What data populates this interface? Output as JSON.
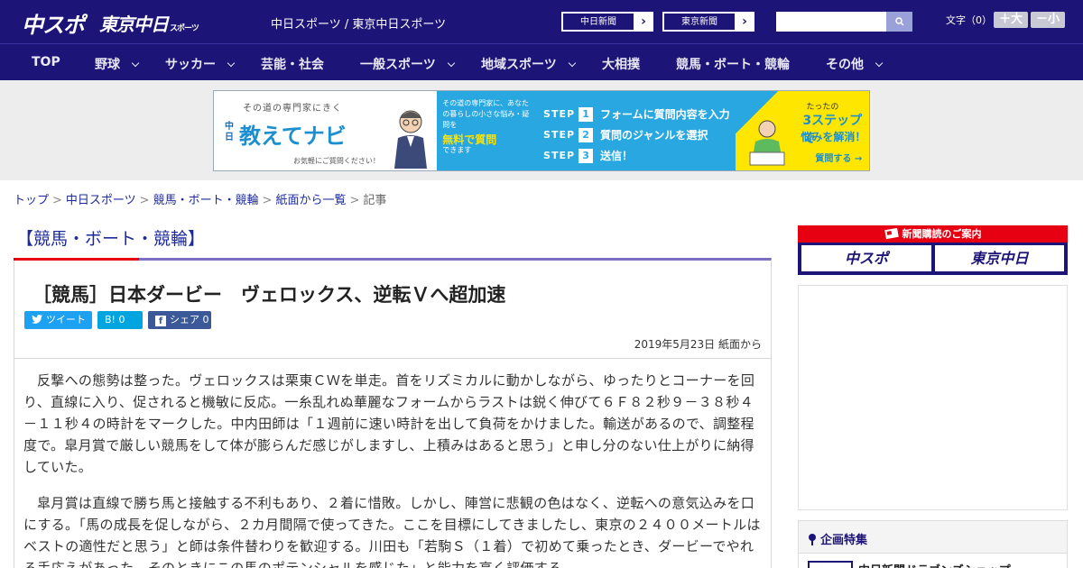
{
  "header": {
    "logo_main": "中スポ",
    "logo_tokyo": "東京中日",
    "logo_tokyo_sub": "スポーツ",
    "site_title": "中日スポーツ / 東京中日スポーツ",
    "link_chunichi": "中日新聞",
    "link_tokyo": "東京新聞",
    "fontsize_label": "文字（0）",
    "fontsize_up": "＋大",
    "fontsize_down": "－小"
  },
  "nav": {
    "items": [
      {
        "label": "TOP"
      },
      {
        "label": "野球"
      },
      {
        "label": "サッカー"
      },
      {
        "label": "芸能・社会"
      },
      {
        "label": "一般スポーツ"
      },
      {
        "label": "地域スポーツ"
      },
      {
        "label": "大相撲"
      },
      {
        "label": "競馬・ボート・競輪"
      },
      {
        "label": "その他"
      }
    ]
  },
  "banner": {
    "tagline": "その道の専門家にきく",
    "brand_small": "中日",
    "brand": "教えてナビ",
    "brand_sub": "お気軽にご質問ください！",
    "mid_text": "その道の専門家に、あなたの暮らしの小さな悩み・疑問を",
    "mid_free": "無料で質問",
    "mid_end": "できます",
    "step_word": "STEP",
    "steps": [
      {
        "num": "1",
        "text": "フォームに質問内容を入力"
      },
      {
        "num": "2",
        "text": "質問のジャンルを選択"
      },
      {
        "num": "3",
        "text": "送信！"
      }
    ],
    "r1": "たったの",
    "r2": "3ステップで",
    "r3": "悩みを解消！",
    "r4": "質問する →"
  },
  "breadcrumb": {
    "items": [
      "トップ",
      "中日スポーツ",
      "競馬・ボート・競輪",
      "紙面から一覧"
    ],
    "current": "記事",
    "sep": ">"
  },
  "article": {
    "category": "【競馬・ボート・競輪】",
    "title": "［競馬］日本ダービー　ヴェロックス、逆転Ｖへ超加速",
    "share_tweet": "ツイート",
    "share_hatena": "B! 0",
    "share_fb": "シェア 0",
    "date": "2019年5月23日 紙面から",
    "paragraphs": [
      "反撃への態勢は整った。ヴェロックスは栗東ＣＷを単走。首をリズミカルに動かしながら、ゆったりとコーナーを回り、直線に入り、促されると機敏に反応。一糸乱れぬ華麗なフォームからラストは鋭く伸びて６Ｆ８２秒９－３８秒４－１１秒４の時計をマークした。中内田師は「１週前に速い時計を出して負荷をかけました。輸送があるので、調整程度で。皐月賞で厳しい競馬をして体が膨らんだ感じがしますし、上積みはあると思う」と申し分のない仕上がりに納得していた。",
      "皐月賞は直線で勝ち馬と接触する不利もあり、２着に惜敗。しかし、陣営に悲観の色はなく、逆転への意気込みを口にする。「馬の成長を促しながら、２カ月間隔で使ってきた。ここを目標にしてきましたし、東京の２４００メートルはベストの適性だと思う」と師は条件替わりを歓迎する。川田も「若駒Ｓ（１着）で初めて乗ったとき、ダービーでやれる手応えがあった。そのときにこの馬のポテンシャルを感じた」と能力を高く評価する。"
    ]
  },
  "sidebar": {
    "subscribe_label": "新聞購読のご案内",
    "sub_logo1": "中スポ",
    "sub_logo2": "東京中日",
    "feature_title": "企画特集",
    "feature_item": "中日新聞ドラゴンズショップ"
  },
  "colors": {
    "navy": "#1c1476",
    "red": "#e60012",
    "link": "#1c2a9e"
  }
}
